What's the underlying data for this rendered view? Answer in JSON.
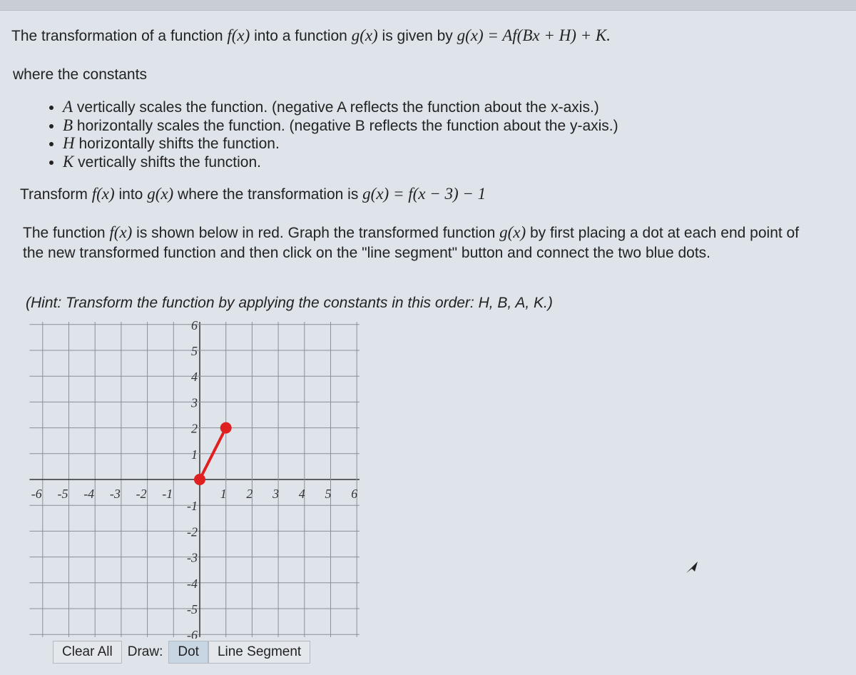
{
  "intro": {
    "prefix": "The transformation of a function ",
    "f": "f(x)",
    "mid": " into a function ",
    "g": "g(x)",
    "suffix": " is given by ",
    "formula": "g(x) = Af(Bx + H) + K."
  },
  "constants_label": "where the constants",
  "constants": [
    {
      "sym": "A",
      "text": " vertically scales the function. (negative A reflects the function about the x-axis.)"
    },
    {
      "sym": "B",
      "text": " horizontally scales the function. (negative B reflects the function about the y-axis.)"
    },
    {
      "sym": "H",
      "text": " horizontally shifts the function."
    },
    {
      "sym": "K",
      "text": " vertically shifts the function."
    }
  ],
  "task": {
    "prefix": "Transform ",
    "f": "f(x)",
    "mid": " into ",
    "g": "g(x)",
    "suffix": " where the transformation is ",
    "formula": "g(x) = f(x − 3) − 1"
  },
  "instructions": {
    "p1": "The function ",
    "f": "f(x)",
    "p2": " is shown below in red. Graph the transformed function ",
    "g": "g(x)",
    "p3": " by first placing a dot at each end point of the new transformed function and then click on the \"line segment\" button and connect the two blue dots."
  },
  "hint": "(Hint: Transform the function by applying the constants in this order: H, B, A, K.)",
  "chart_data": {
    "type": "line",
    "xlim": [
      -6,
      6
    ],
    "ylim": [
      -6,
      6
    ],
    "x_ticks": [
      "-6",
      "-5",
      "-4",
      "-3",
      "-2",
      "-1",
      "1",
      "2",
      "3",
      "4",
      "5",
      "6"
    ],
    "y_ticks": [
      "6",
      "5",
      "4",
      "3",
      "2",
      "1",
      "-1",
      "-2",
      "-3",
      "-4",
      "-5",
      "-6"
    ],
    "grid": true,
    "series": [
      {
        "color": "#e02020",
        "points": [
          [
            0,
            0
          ],
          [
            1,
            2
          ]
        ]
      }
    ]
  },
  "toolbar": {
    "clear_all": "Clear All",
    "draw_label": "Draw:",
    "dot": "Dot",
    "line_segment": "Line Segment",
    "active_tool": "Dot"
  }
}
